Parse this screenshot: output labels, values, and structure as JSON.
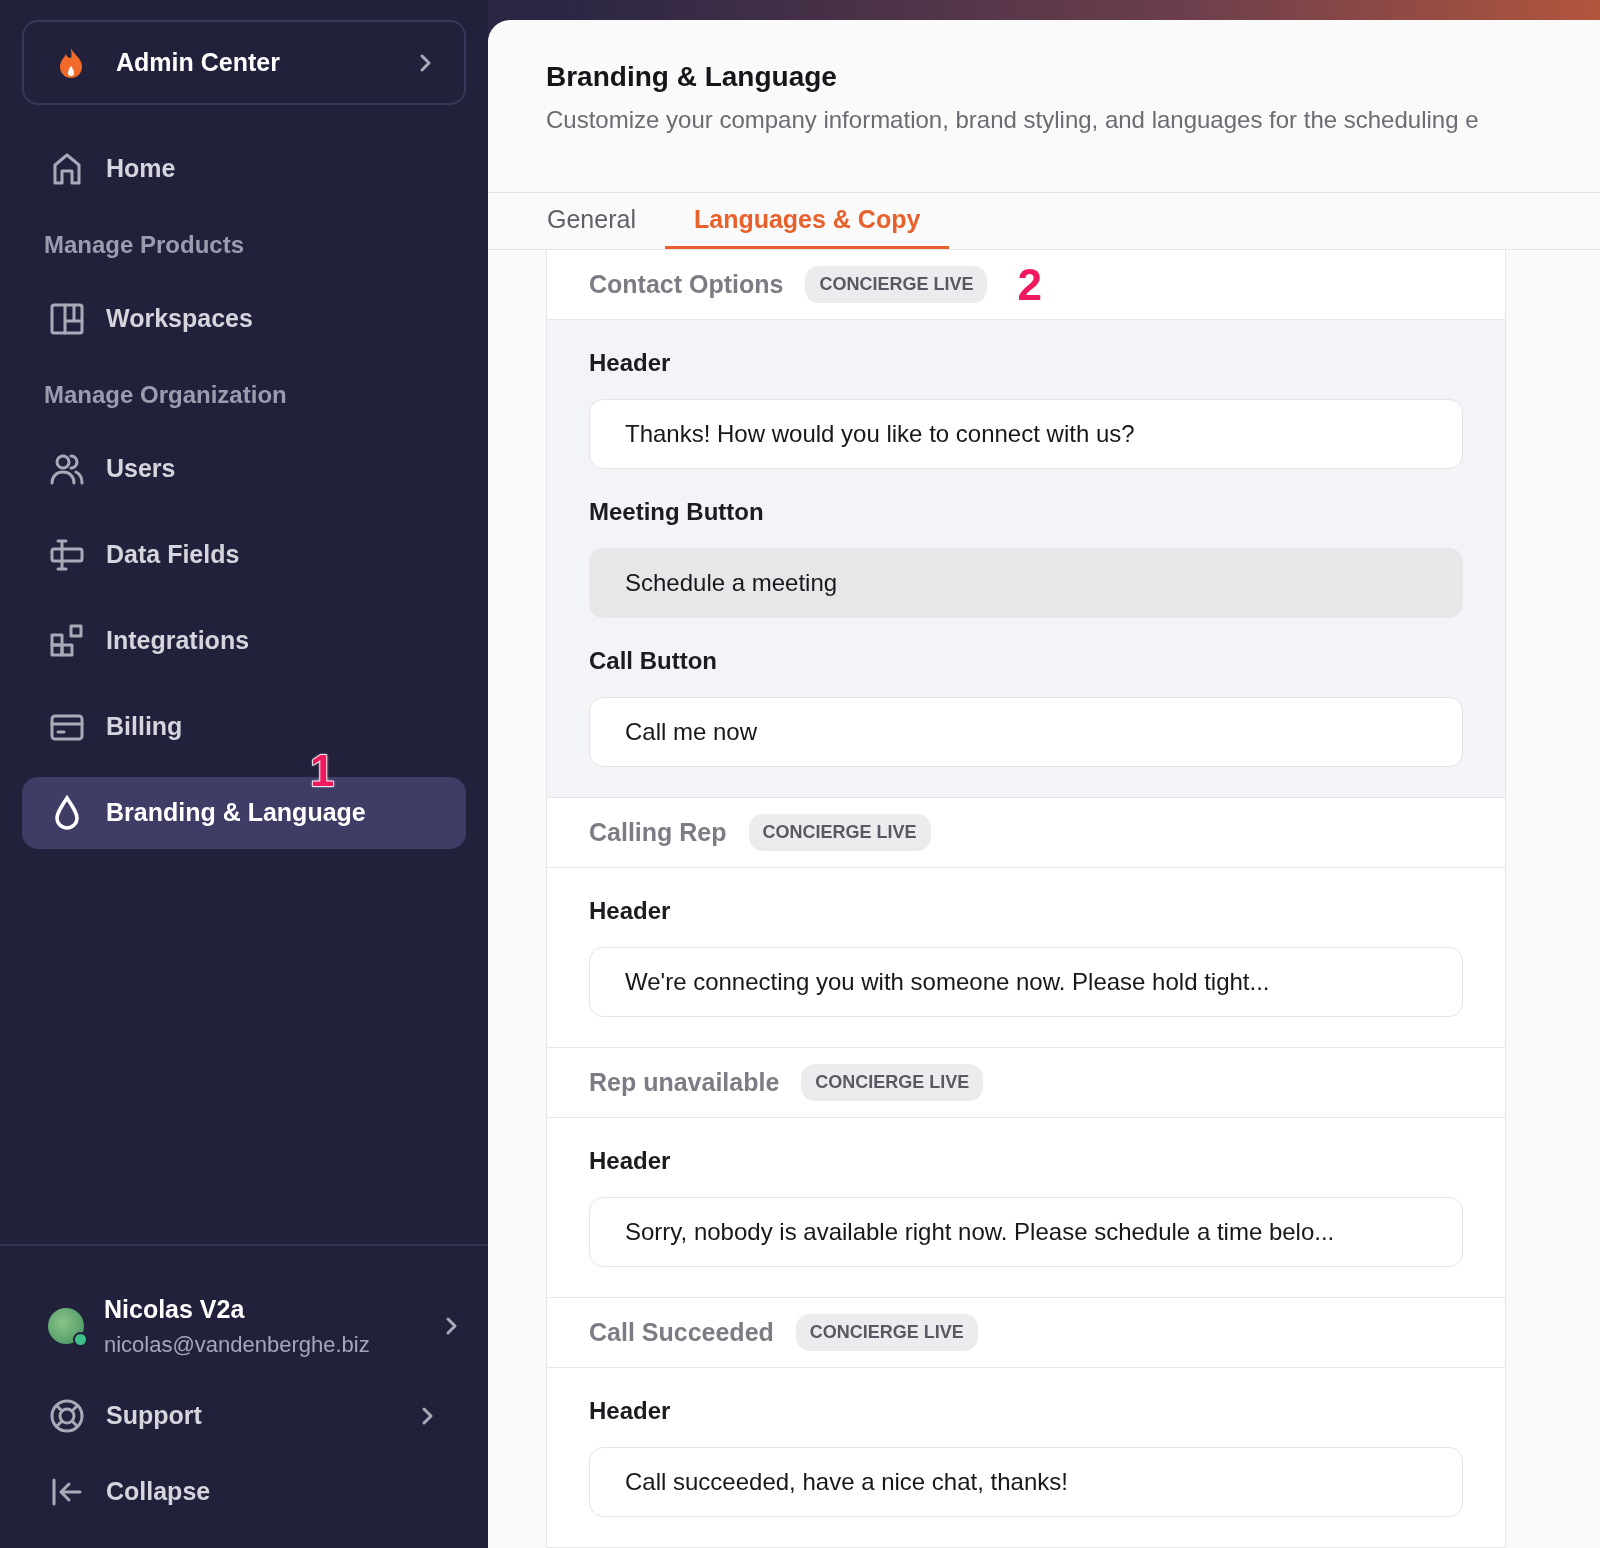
{
  "sidebar": {
    "org": {
      "name": "Admin Center"
    },
    "items": [
      {
        "kind": "link",
        "label": "Home",
        "selected": false
      },
      {
        "kind": "heading",
        "label": "Manage Products"
      },
      {
        "kind": "link",
        "label": "Workspaces",
        "selected": false
      },
      {
        "kind": "heading",
        "label": "Manage Organization"
      },
      {
        "kind": "link",
        "label": "Users",
        "selected": false
      },
      {
        "kind": "link",
        "label": "Data Fields",
        "selected": false
      },
      {
        "kind": "link",
        "label": "Integrations",
        "selected": false
      },
      {
        "kind": "link",
        "label": "Billing",
        "selected": false
      },
      {
        "kind": "link",
        "label": "Branding & Language",
        "selected": true,
        "marker": "1"
      }
    ],
    "user": {
      "name": "Nicolas V2a",
      "email": "nicolas@vandenberghe.biz"
    },
    "footer": [
      {
        "label": "Support",
        "chevron": true
      },
      {
        "label": "Collapse",
        "chevron": false
      }
    ]
  },
  "page": {
    "title": "Branding & Language",
    "subtitle": "Customize your company information, brand styling, and languages for the scheduling e"
  },
  "tabs": [
    {
      "label": "General",
      "selected": false
    },
    {
      "label": "Languages & Copy",
      "selected": true
    }
  ],
  "sections": [
    {
      "title": "Contact Options",
      "badge": "CONCIERGE LIVE",
      "highlighted": true,
      "marker": "2",
      "fields": [
        {
          "label": "Header",
          "value": "Thanks! How would you like to connect with us?",
          "highlighted": false
        },
        {
          "label": "Meeting Button",
          "value": "Schedule a meeting",
          "highlighted": true
        },
        {
          "label": "Call Button",
          "value": "Call me now",
          "highlighted": false
        }
      ]
    },
    {
      "title": "Calling Rep",
      "badge": "CONCIERGE LIVE",
      "highlighted": false,
      "fields": [
        {
          "label": "Header",
          "value": "We're connecting you with someone now. Please hold tight...",
          "highlighted": false
        }
      ]
    },
    {
      "title": "Rep unavailable",
      "badge": "CONCIERGE LIVE",
      "highlighted": false,
      "fields": [
        {
          "label": "Header",
          "value": "Sorry, nobody is available right now. Please schedule a time belo...",
          "highlighted": false
        }
      ]
    },
    {
      "title": "Call Succeeded",
      "badge": "CONCIERGE LIVE",
      "highlighted": false,
      "fields": [
        {
          "label": "Header",
          "value": "Call succeeded, have a nice chat, thanks!",
          "highlighted": false
        }
      ]
    }
  ]
}
